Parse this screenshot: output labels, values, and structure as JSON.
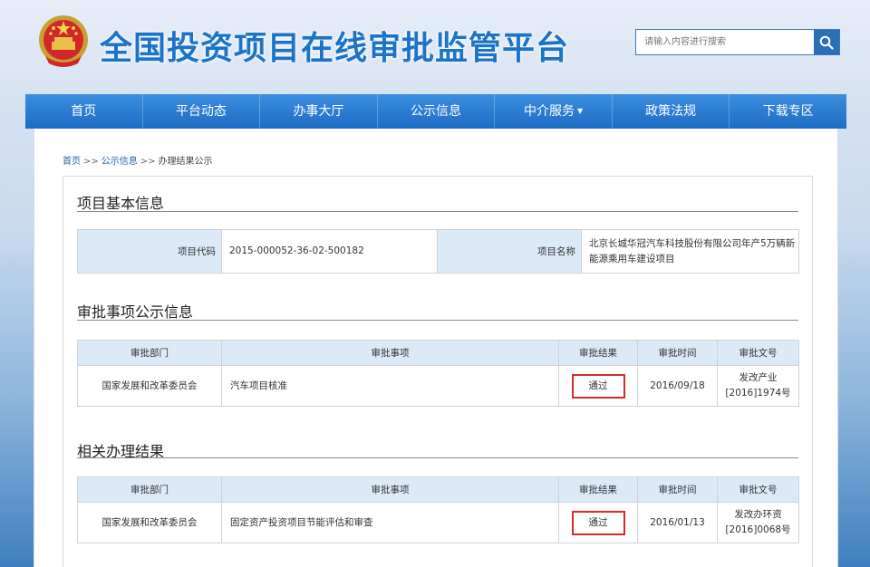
{
  "header": {
    "title": "全国投资项目在线审批监管平台",
    "search_placeholder": "请输入内容进行搜索"
  },
  "nav": {
    "items": [
      "首页",
      "平台动态",
      "办事大厅",
      "公示信息",
      "中介服务",
      "政策法规",
      "下载专区"
    ]
  },
  "breadcrumb": [
    "首页",
    "公示信息",
    "办理结果公示"
  ],
  "breadcrumb_sep": ">>",
  "basic_info": {
    "title": "项目基本信息",
    "code_label": "项目代码",
    "code_value": "2015-000052-36-02-500182",
    "name_label": "项目名称",
    "name_value": "北京长城华冠汽车科技股份有限公司年产5万辆新能源乘用车建设项目"
  },
  "approval_notice": {
    "title": "审批事项公示信息",
    "headers": [
      "审批部门",
      "审批事项",
      "审批结果",
      "审批时间",
      "审批文号"
    ],
    "row": {
      "dept": "国家发展和改革委员会",
      "item": "汽车项目核准",
      "result": "通过",
      "date": "2016/09/18",
      "doc_line1": "发改产业",
      "doc_line2": "[2016]1974号"
    }
  },
  "related_results": {
    "title": "相关办理结果",
    "headers": [
      "审批部门",
      "审批事项",
      "审批结果",
      "审批时间",
      "审批文号"
    ],
    "row": {
      "dept": "国家发展和改革委员会",
      "item": "固定资产投资项目节能评估和审查",
      "result": "通过",
      "date": "2016/01/13",
      "doc_line1": "发改办环资",
      "doc_line2": "[2016]0068号"
    }
  },
  "colors": {
    "brand_blue": "#1b74c8",
    "nav_blue": "#1c6cc4",
    "header_cell": "#dceaf8",
    "highlight_red": "#d52a2a"
  }
}
